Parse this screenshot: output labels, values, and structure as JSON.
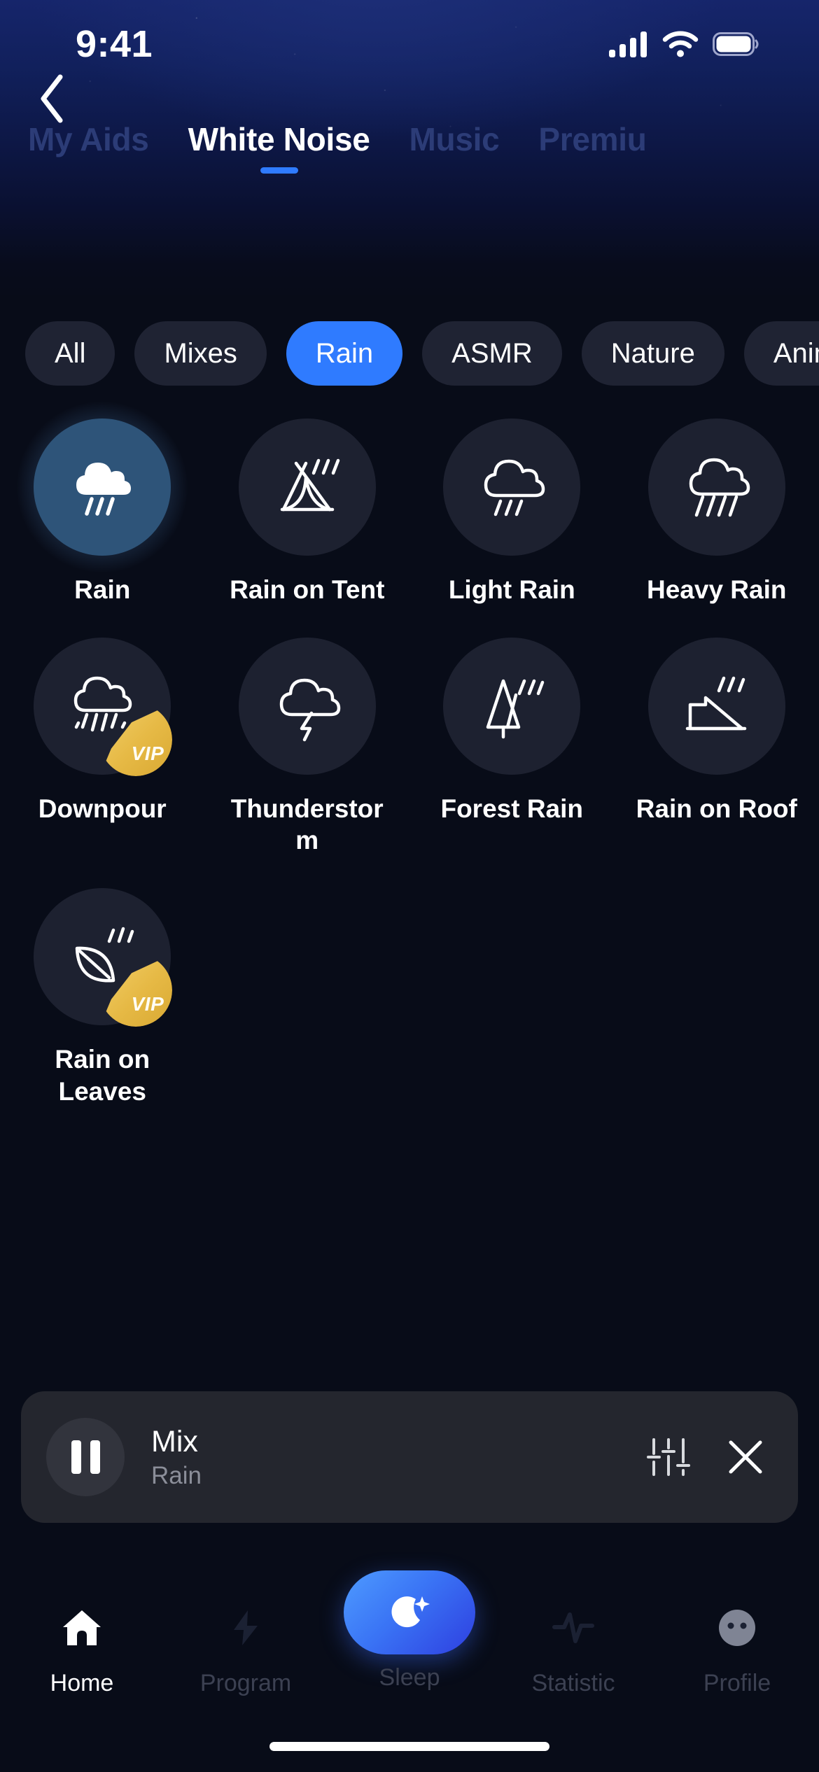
{
  "status_bar": {
    "time": "9:41",
    "cellular_icon": "cellular-bars-icon",
    "wifi_icon": "wifi-icon",
    "battery_icon": "battery-icon"
  },
  "nav": {
    "back_icon": "back-chevron-icon"
  },
  "top_tabs": {
    "active": "White Noise",
    "items": [
      {
        "label": "My Aids",
        "active": false
      },
      {
        "label": "White Noise",
        "active": true
      },
      {
        "label": "Music",
        "active": false
      },
      {
        "label": "Premiu",
        "active": false
      }
    ]
  },
  "categories": {
    "active": "Rain",
    "items": [
      {
        "label": "All",
        "active": false
      },
      {
        "label": "Mixes",
        "active": false
      },
      {
        "label": "Rain",
        "active": true
      },
      {
        "label": "ASMR",
        "active": false
      },
      {
        "label": "Nature",
        "active": false
      },
      {
        "label": "Anim",
        "active": false
      }
    ]
  },
  "sounds": [
    {
      "label": "Rain",
      "icon": "cloud-rain-filled-icon",
      "selected": true,
      "vip": false,
      "vip_label": "VIP"
    },
    {
      "label": "Rain on Tent",
      "icon": "tent-rain-icon",
      "selected": false,
      "vip": false,
      "vip_label": "VIP"
    },
    {
      "label": "Light Rain",
      "icon": "cloud-light-rain-icon",
      "selected": false,
      "vip": false,
      "vip_label": "VIP"
    },
    {
      "label": "Heavy Rain",
      "icon": "cloud-heavy-rain-icon",
      "selected": false,
      "vip": false,
      "vip_label": "VIP"
    },
    {
      "label": "Downpour",
      "icon": "cloud-downpour-icon",
      "selected": false,
      "vip": true,
      "vip_label": "VIP"
    },
    {
      "label": "Thunderstorm",
      "icon": "cloud-lightning-icon",
      "selected": false,
      "vip": false,
      "vip_label": "VIP"
    },
    {
      "label": "Forest Rain",
      "icon": "tree-rain-icon",
      "selected": false,
      "vip": false,
      "vip_label": "VIP"
    },
    {
      "label": "Rain on Roof",
      "icon": "roof-rain-icon",
      "selected": false,
      "vip": false,
      "vip_label": "VIP"
    },
    {
      "label": "Rain on Leaves",
      "icon": "leaf-rain-icon",
      "selected": false,
      "vip": true,
      "vip_label": "VIP"
    }
  ],
  "mini_player": {
    "title": "Mix",
    "subtitle": "Rain",
    "play_state_icon": "pause-icon",
    "mixer_icon": "equalizer-sliders-icon",
    "close_icon": "close-x-icon"
  },
  "bottom_nav": {
    "active": "Home",
    "items": [
      {
        "label": "Home",
        "icon": "home-icon",
        "active": true
      },
      {
        "label": "Program",
        "icon": "bolt-icon",
        "active": false
      },
      {
        "label": "Sleep",
        "icon": "moon-star-icon",
        "active": false
      },
      {
        "label": "Statistic",
        "icon": "pulse-wave-icon",
        "active": false
      },
      {
        "label": "Profile",
        "icon": "profile-face-icon",
        "active": false
      }
    ]
  },
  "colors": {
    "accent_blue": "#2f7bff",
    "vip_gold": "#e6b945",
    "selected_tile": "#2e5479",
    "tile": "#1d2130",
    "background": "#080c18"
  }
}
